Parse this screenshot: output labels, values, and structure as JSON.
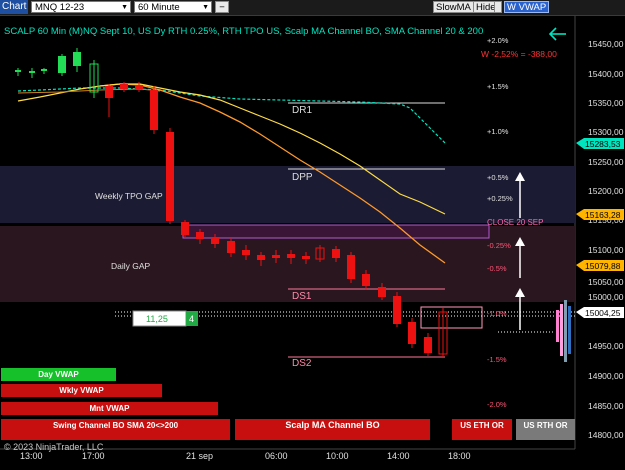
{
  "toolbar": {
    "chart_label": "Chart",
    "instrument": "MNQ 12-23",
    "interval": "60 Minute",
    "slowma_btn": "SlowMA",
    "hide_btn": "Hide",
    "vwap_btn": "W VWAP"
  },
  "chart": {
    "title": "SCALP 60 Min (M)NQ Sept 10, US Dy RTH 0.25%, RTH TPO US, Scalp MA Channel BO, SMA Channel 20 & 200",
    "weekly_pnl": "W -2,52% = -388,00",
    "copyright": "© 2023 NinjaTrader, LLC",
    "colors": {
      "up": "#22dd55",
      "down": "#ee1111",
      "accent": "#00e5c0",
      "orange": "#ff9a2a"
    }
  },
  "price_axis": {
    "ticks": [
      "15450,00",
      "15400,00",
      "15350,00",
      "15300,00",
      "15250,00",
      "15200,00",
      "15150,00",
      "15100,00",
      "15050,00",
      "15000,00",
      "14950,00",
      "14900,00",
      "14850,00",
      "14800,00"
    ],
    "tags": [
      {
        "text": "15283,53",
        "color": "#00e5c0",
        "fg": "#000"
      },
      {
        "text": "15163,28",
        "color": "#ffb400",
        "fg": "#000"
      },
      {
        "text": "15079,88",
        "color": "#ffb400",
        "fg": "#000"
      },
      {
        "text": "15004,25",
        "color": "#ffffff",
        "fg": "#000"
      }
    ]
  },
  "time_axis": {
    "ticks": [
      "13:00",
      "17:00",
      "21 sep",
      "06:00",
      "10:00",
      "14:00",
      "18:00"
    ]
  },
  "zones": [
    {
      "label": "Weekly TPO GAP"
    },
    {
      "label": "Daily GAP"
    }
  ],
  "level_labels": [
    "DR1",
    "DPP",
    "DS1",
    "DS2"
  ],
  "percent_labels": [
    "+2.0%",
    "+1.5%",
    "+1.0%",
    "+0.5%",
    "+0.25%",
    "-0.25%",
    "-0.5%",
    "-1.0%",
    "-1.5%",
    "-2.0%"
  ],
  "close_label": "CLOSE 20 SEP",
  "position": {
    "price": "11,25",
    "qty": "4"
  },
  "buttons": {
    "day_vwap": "Day VWAP",
    "wkly_vwap": "Wkly VWAP",
    "mnt_vwap": "Mnt VWAP",
    "swing": "Swing Channel BO SMA 20<>200",
    "scalp": "Scalp MA Channel BO",
    "us_eth": "US ETH OR",
    "us_rth": "US RTH OR"
  },
  "icons": {
    "back": "arrow-left-icon"
  }
}
